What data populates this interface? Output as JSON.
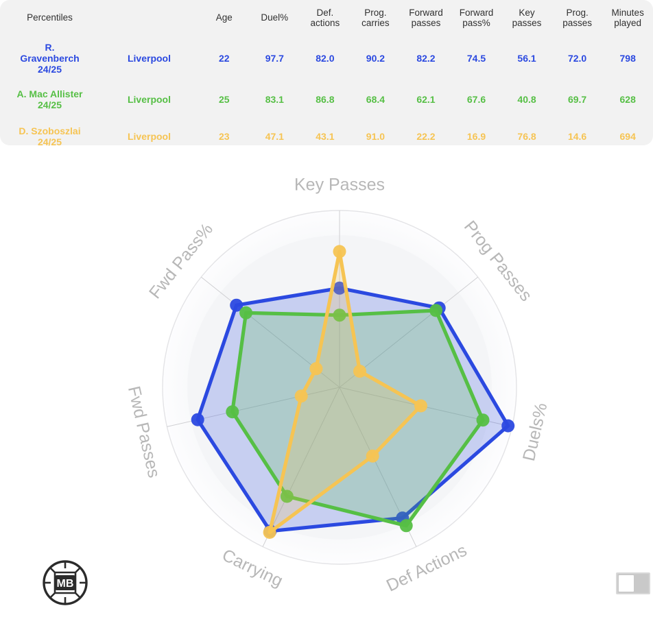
{
  "table": {
    "title": "Percentiles",
    "columns": [
      "Percentiles",
      "",
      "Age",
      "Duel%",
      "Def. actions",
      "Prog. carries",
      "Forward passes",
      "Forward pass%",
      "Key passes",
      "Prog. passes",
      "Minutes played"
    ],
    "columns_wrapped": [
      {
        "line1": "Percentiles",
        "line2": ""
      },
      {
        "line1": "",
        "line2": ""
      },
      {
        "line1": "Age",
        "line2": ""
      },
      {
        "line1": "Duel%",
        "line2": ""
      },
      {
        "line1": "Def.",
        "line2": "actions"
      },
      {
        "line1": "Prog.",
        "line2": "carries"
      },
      {
        "line1": "Forward",
        "line2": "passes"
      },
      {
        "line1": "Forward",
        "line2": "pass%"
      },
      {
        "line1": "Key",
        "line2": "passes"
      },
      {
        "line1": "Prog.",
        "line2": "passes"
      },
      {
        "line1": "Minutes",
        "line2": "played"
      }
    ],
    "rows": [
      {
        "name_line1": "R.",
        "name_line2": "Gravenberch",
        "season": "24/25",
        "team": "Liverpool",
        "age": "22",
        "duel_pct": "97.7",
        "def_actions": "82.0",
        "prog_carries": "90.2",
        "forward_passes": "82.2",
        "forward_pass_pct": "74.5",
        "key_passes": "56.1",
        "prog_passes": "72.0",
        "minutes_played": "798",
        "color": "#2b49e0"
      },
      {
        "name_line1": "A. Mac Allister",
        "name_line2": "",
        "season": "24/25",
        "team": "Liverpool",
        "age": "25",
        "duel_pct": "83.1",
        "def_actions": "86.8",
        "prog_carries": "68.4",
        "forward_passes": "62.1",
        "forward_pass_pct": "67.6",
        "key_passes": "40.8",
        "prog_passes": "69.7",
        "minutes_played": "628",
        "color": "#56bf45"
      },
      {
        "name_line1": "D. Szoboszlai",
        "name_line2": "",
        "season": "24/25",
        "team": "Liverpool",
        "age": "23",
        "duel_pct": "47.1",
        "def_actions": "43.1",
        "prog_carries": "91.0",
        "forward_passes": "22.2",
        "forward_pass_pct": "16.9",
        "key_passes": "76.8",
        "prog_passes": "14.6",
        "minutes_played": "694",
        "color": "#f6c453"
      }
    ]
  },
  "chart_data": {
    "type": "radar",
    "title": "",
    "axes": [
      "Key Passes",
      "Prog Passes",
      "Duels%",
      "Def Actions",
      "Carrying",
      "Fwd Passes",
      "Fwd Pass%"
    ],
    "rlim": [
      0,
      100
    ],
    "grid": true,
    "legend": "none",
    "series": [
      {
        "name": "R. Gravenberch 24/25",
        "color": "#2b49e0",
        "values": [
          56.1,
          72.0,
          97.7,
          82.0,
          90.2,
          82.2,
          74.5
        ]
      },
      {
        "name": "A. Mac Allister 24/25",
        "color": "#56bf45",
        "values": [
          40.8,
          69.7,
          83.1,
          86.8,
          68.4,
          62.1,
          67.6
        ]
      },
      {
        "name": "D. Szoboszlai 24/25",
        "color": "#f6c453",
        "values": [
          76.8,
          14.6,
          47.1,
          43.1,
          91.0,
          22.2,
          16.9
        ]
      }
    ]
  },
  "footer": {
    "logo_text": "MB",
    "logo_name": "mb-football-logo"
  }
}
